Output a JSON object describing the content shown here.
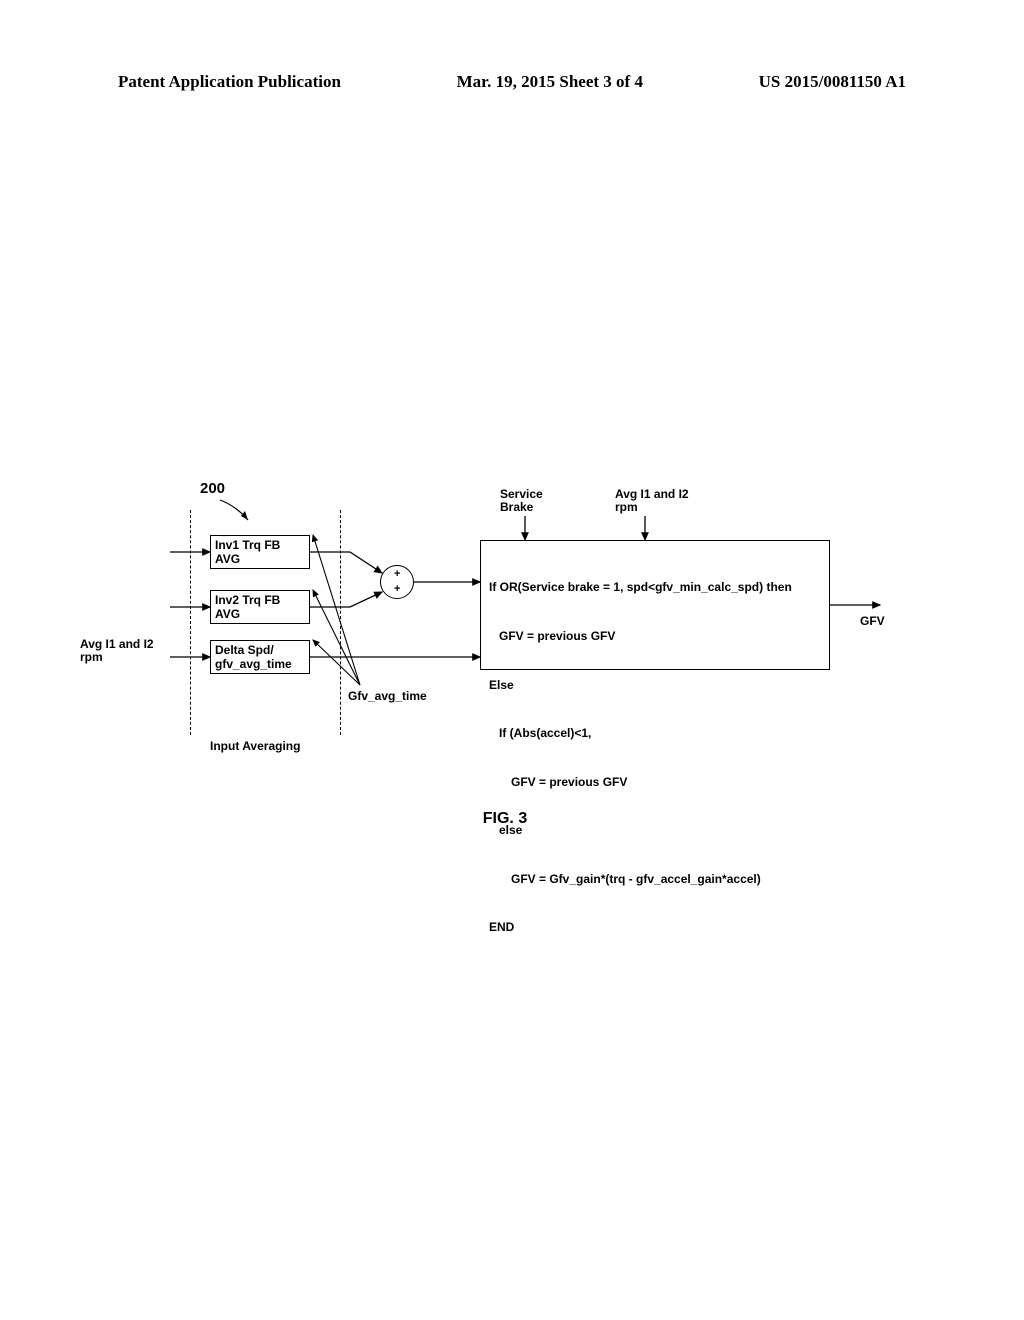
{
  "header": {
    "left": "Patent Application Publication",
    "center": "Mar. 19, 2015  Sheet 3 of 4",
    "right": "US 2015/0081150 A1"
  },
  "diagram": {
    "ref_number": "200",
    "box_inv1": "Inv1 Trq FB\nAVG",
    "box_inv2": "Inv2 Trq FB\nAVG",
    "box_delta": "Delta Spd/\ngfv_avg_time",
    "sum_plus": "+",
    "label_avg_rpm": "Avg I1 and\nI2 rpm",
    "label_service_brake": "Service\nBrake",
    "label_gfv_out": "GFV",
    "label_gfv_avg_time": "Gfv_avg_time",
    "label_input_averaging": "Input\nAveraging",
    "logic": {
      "l1": "If OR(Service brake = 1, spd<gfv_min_calc_spd) then",
      "l2": "GFV = previous GFV",
      "l3": "Else",
      "l4": "If (Abs(accel)<1,",
      "l5": "GFV = previous GFV",
      "l6": "else",
      "l7": "GFV = Gfv_gain*(trq - gfv_accel_gain*accel)",
      "l8": "END"
    }
  },
  "caption": "FIG. 3"
}
